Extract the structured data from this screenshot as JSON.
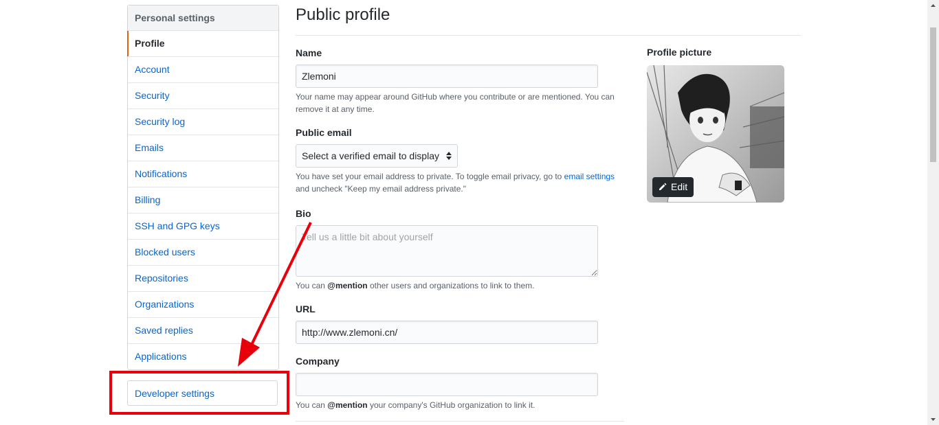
{
  "sidebar": {
    "header": "Personal settings",
    "items": [
      {
        "label": "Profile",
        "selected": true
      },
      {
        "label": "Account"
      },
      {
        "label": "Security"
      },
      {
        "label": "Security log"
      },
      {
        "label": "Emails"
      },
      {
        "label": "Notifications"
      },
      {
        "label": "Billing"
      },
      {
        "label": "SSH and GPG keys"
      },
      {
        "label": "Blocked users"
      },
      {
        "label": "Repositories"
      },
      {
        "label": "Organizations"
      },
      {
        "label": "Saved replies"
      },
      {
        "label": "Applications"
      }
    ],
    "developer_settings": "Developer settings"
  },
  "main": {
    "title": "Public profile",
    "name": {
      "label": "Name",
      "value": "Zlemoni",
      "note": "Your name may appear around GitHub where you contribute or are mentioned. You can remove it at any time."
    },
    "public_email": {
      "label": "Public email",
      "selected": "Select a verified email to display",
      "note_before": "You have set your email address to private. To toggle email privacy, go to ",
      "note_link": "email settings",
      "note_after": " and uncheck \"Keep my email address private.\""
    },
    "bio": {
      "label": "Bio",
      "placeholder": "Tell us a little bit about yourself",
      "note_before": "You can ",
      "note_mention": "@mention",
      "note_after": " other users and organizations to link to them."
    },
    "url": {
      "label": "URL",
      "value": "http://www.zlemoni.cn/"
    },
    "company": {
      "label": "Company",
      "value": "",
      "note_before": "You can ",
      "note_mention": "@mention",
      "note_after": " your company's GitHub organization to link it."
    }
  },
  "profile_picture": {
    "label": "Profile picture",
    "edit_label": "Edit",
    "edit_icon": "pencil-icon"
  },
  "colors": {
    "link": "#0366d6",
    "selected_accent": "#e36209",
    "annotation_red": "#e8000b"
  }
}
